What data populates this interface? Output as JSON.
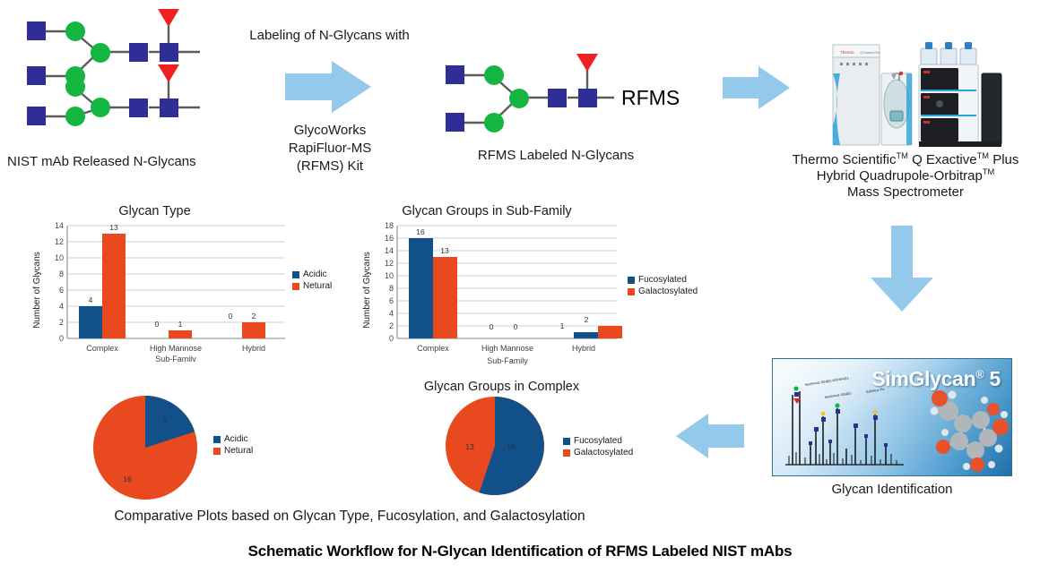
{
  "figure": {
    "main_title": "Schematic Workflow for N-Glycan Identification of RFMS Labeled NIST mAbs",
    "plots_caption": "Comparative Plots based on Glycan Type, Fucosylation, and Galactosylation"
  },
  "steps": {
    "released_glycans_caption": "NIST mAb Released N-Glycans",
    "labeling_header": "Labeling of N-Glycans with",
    "kit_line1": "GlycoWorks",
    "kit_line2": "RapiFluor-MS",
    "kit_line3": "(RFMS) Kit",
    "rfms_tag": "RFMS",
    "labeled_glycans_caption": "RFMS Labeled N-Glycans",
    "instrument_line1_a": "Thermo Scientific",
    "instrument_line1_b": " Q Exactive",
    "instrument_line1_c": " Plus",
    "instrument_line2_a": "Hybrid Quadrupole-Orbitrap",
    "instrument_line3": "Mass Spectrometer",
    "trademark": "TM",
    "software_name": "SimGlycan",
    "software_version": "5",
    "software_registered": "®",
    "software_caption": "Glycan Identification"
  },
  "colors": {
    "series_blue": "#12508a",
    "series_orange": "#e8491e",
    "arrow_blue": "#95c9ec",
    "glcnac_blue": "#2e2e96",
    "mannose_green": "#15b542",
    "fucose_red": "#ee2020",
    "bond_gray": "#5c5c5c",
    "title_black": "#000000"
  },
  "chart_data": [
    {
      "id": "bar-glycan-type",
      "type": "bar",
      "title": "Glycan Type",
      "xlabel": "Sub-Family",
      "ylabel": "Number of Glycans",
      "categories": [
        "Complex",
        "High Mannose",
        "Hybrid"
      ],
      "ylim": [
        0,
        14
      ],
      "yticks": [
        0,
        2,
        4,
        6,
        8,
        10,
        12,
        14
      ],
      "grid": true,
      "legend_position": "right",
      "series": [
        {
          "name": "Acidic",
          "color": "#12508a",
          "values": [
            4,
            0,
            0
          ]
        },
        {
          "name": "Netural",
          "color": "#e8491e",
          "values": [
            13,
            1,
            2
          ]
        }
      ]
    },
    {
      "id": "bar-groups-subfamily",
      "type": "bar",
      "title": "Glycan Groups in Sub-Family",
      "xlabel": "Sub-Family",
      "ylabel": "Number of Glycans",
      "categories": [
        "Complex",
        "High Mannose",
        "Hybrid"
      ],
      "ylim": [
        0,
        18
      ],
      "yticks": [
        0,
        2,
        4,
        6,
        8,
        10,
        12,
        14,
        16,
        18
      ],
      "grid": true,
      "legend_position": "right",
      "series": [
        {
          "name": "Fucosylated",
          "color": "#12508a",
          "values": [
            16,
            0,
            1
          ]
        },
        {
          "name": "Galactosylated",
          "color": "#e8491e",
          "values": [
            13,
            0,
            2
          ]
        }
      ]
    },
    {
      "id": "pie-glycan-type",
      "type": "pie",
      "title": "",
      "legend_position": "right",
      "slices": [
        {
          "name": "Acidic",
          "value": 4,
          "color": "#12508a"
        },
        {
          "name": "Netural",
          "value": 16,
          "color": "#e8491e"
        }
      ]
    },
    {
      "id": "pie-groups-complex",
      "type": "pie",
      "title": "Glycan Groups in Complex",
      "legend_position": "right",
      "slices": [
        {
          "name": "Fucosylated",
          "value": 16,
          "color": "#12508a"
        },
        {
          "name": "Galactosylated",
          "value": 13,
          "color": "#e8491e"
        }
      ]
    }
  ]
}
